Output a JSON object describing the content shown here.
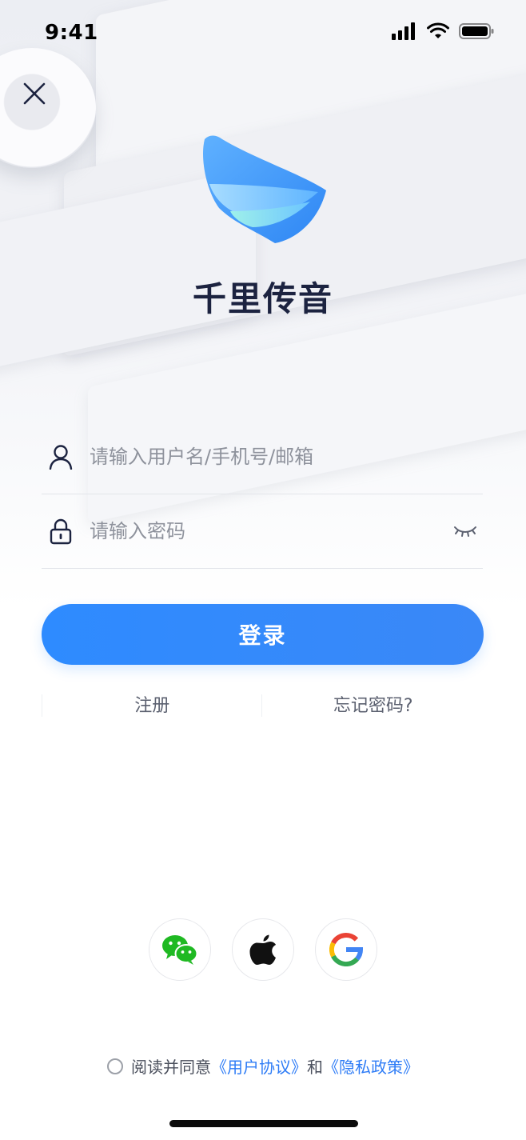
{
  "status_bar": {
    "time": "9:41"
  },
  "app": {
    "name": "千里传音"
  },
  "form": {
    "username_placeholder": "请输入用户名/手机号/邮箱",
    "password_placeholder": "请输入密码"
  },
  "actions": {
    "login_label": "登录",
    "register_label": "注册",
    "forgot_label": "忘记密码?"
  },
  "social_login": [
    {
      "icon": "wechat-icon"
    },
    {
      "icon": "apple-icon"
    },
    {
      "icon": "google-icon"
    }
  ],
  "agreement": {
    "prefix": "阅读并同意",
    "terms": "《用户协议》",
    "conjunction": "和",
    "privacy": "《隐私政策》"
  },
  "colors": {
    "primary": "#2e8bff",
    "link": "#2e7cf6",
    "title": "#1c2340",
    "wechat": "#1fb922"
  }
}
